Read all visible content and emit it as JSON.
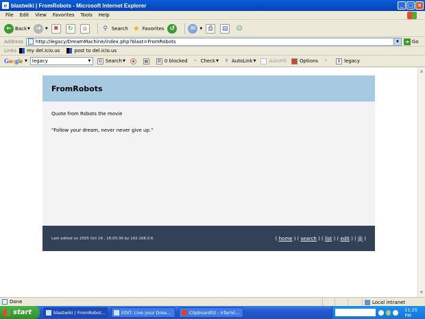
{
  "window": {
    "title": "blastwiki | FromRobots - Microsoft Internet Explorer",
    "controls": [
      "_",
      "□",
      "×"
    ]
  },
  "menu": [
    "File",
    "Edit",
    "View",
    "Favorites",
    "Tools",
    "Help"
  ],
  "toolbar": {
    "back_label": "Back",
    "search_label": "Search",
    "favorites_label": "Favorites"
  },
  "address": {
    "label": "Address",
    "url": "http://legacy/DreamMachine/index.php?blast=FromRobots",
    "go_label": "Go"
  },
  "links": {
    "label": "Links",
    "items": [
      "my del.icio.us",
      "post to del.icio.us"
    ]
  },
  "google": {
    "logo": [
      "G",
      "o",
      "o",
      "g",
      "l",
      "e"
    ],
    "query": "legacy",
    "search_label": "Search",
    "blocked_label": "0 blocked",
    "check_label": "Check",
    "autolink_label": "AutoLink",
    "autofill_label": "AutoFill",
    "options_label": "Options",
    "legacy_label": "legacy"
  },
  "wiki": {
    "title": "FromRobots",
    "intro": "Quote from Robots the movie",
    "quote": "\"Follow your dream, never never give up.\"",
    "footer_edit": "Last edited on 2005 Oct 16 , 16:05:36 by 192.168.0.6.",
    "footer_links": [
      "home",
      "search",
      "list",
      "edit",
      "@"
    ]
  },
  "status": {
    "text": "Done",
    "zone": "Local intranet"
  },
  "taskbar": {
    "start_label": "start",
    "tasks": [
      "blastwiki | FromRobot...",
      "EDIT: Live your Drea...",
      "Clipboard02 - IrfanVi..."
    ],
    "clock": "11:25 PM"
  },
  "colors": {
    "wiki_header": "#a7c9e2",
    "wiki_footer": "#324158",
    "wiki_body": "#f3f3f3"
  }
}
